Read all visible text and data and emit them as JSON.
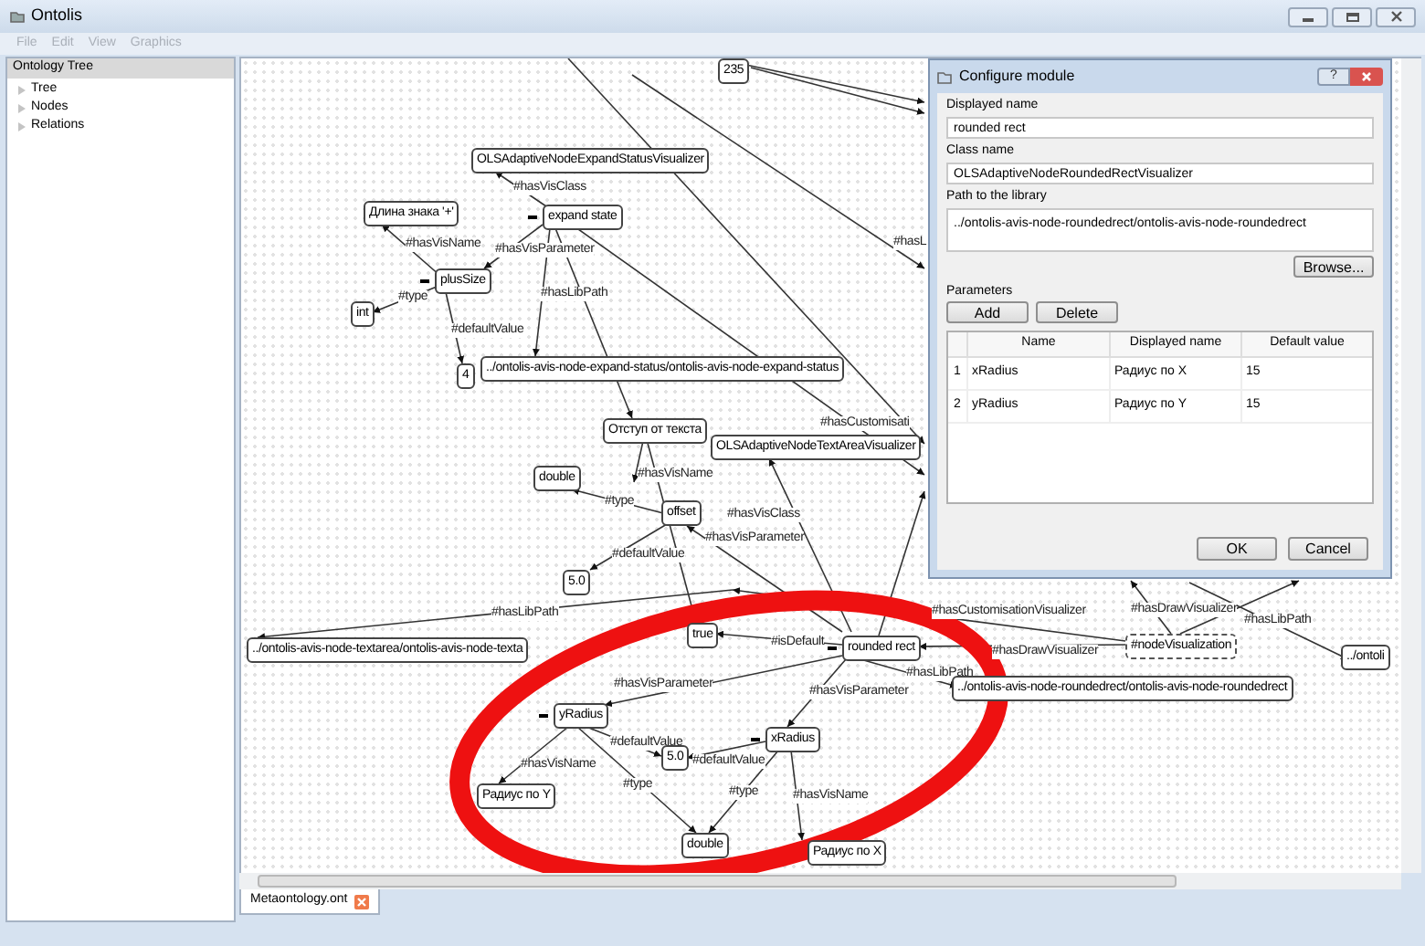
{
  "window": {
    "title": "Ontolis"
  },
  "menu": [
    {
      "label": "File",
      "disabled": true
    },
    {
      "label": "Edit",
      "disabled": true
    },
    {
      "label": "View",
      "disabled": true
    },
    {
      "label": "Graphics",
      "disabled": true
    }
  ],
  "sidebar": {
    "title": "Ontology Tree",
    "items": [
      {
        "label": "Tree",
        "expanded": false
      },
      {
        "label": "Nodes",
        "expanded": false
      },
      {
        "label": "Relations",
        "expanded": false
      }
    ]
  },
  "graph": {
    "nodes": [
      {
        "label": "235",
        "dashed": false
      },
      {
        "label": "OLSAdaptiveNodeExpandStatusVisualizer",
        "dashed": false
      },
      {
        "label": "Длина знака '+'",
        "dashed": false
      },
      {
        "label": "expand state",
        "dashed": false,
        "expanded": true
      },
      {
        "label": "plusSize",
        "dashed": false,
        "expanded": true
      },
      {
        "label": "int",
        "dashed": false
      },
      {
        "label": "4",
        "dashed": false
      },
      {
        "label": "../ontolis-avis-node-expand-status/ontolis-avis-node-expand-status",
        "dashed": false
      },
      {
        "label": "Отступ от текста",
        "dashed": false
      },
      {
        "label": "OLSAdaptiveNodeTextAreaVisualizer",
        "dashed": false
      },
      {
        "label": "double",
        "dashed": false
      },
      {
        "label": "offset",
        "dashed": false
      },
      {
        "label": "5.0",
        "dashed": false
      },
      {
        "label": "true",
        "dashed": false
      },
      {
        "label": "../ontolis-avis-node-textarea/ontolis-avis-node-texta",
        "dashed": false
      },
      {
        "label": "rounded rect",
        "dashed": false,
        "expanded": true
      },
      {
        "label": "#nodeVisualization",
        "dashed": true
      },
      {
        "label": "../ontolis-avis-node-roundedrect/ontolis-avis-node-roundedrect",
        "dashed": false
      },
      {
        "label": "../ontoli",
        "dashed": false
      },
      {
        "label": "yRadius",
        "dashed": false,
        "expanded": true
      },
      {
        "label": "xRadius",
        "dashed": false,
        "expanded": true
      },
      {
        "label": "5.0",
        "dashed": false
      },
      {
        "label": "Радиус по Y",
        "dashed": false
      },
      {
        "label": "double",
        "dashed": false
      },
      {
        "label": "Радиус по X",
        "dashed": false
      }
    ],
    "edge_labels": [
      "#hasVisClass",
      "#hasVisName",
      "#hasVisParameter",
      "#type",
      "#hasLibPath",
      "#defaultValue",
      "#hasL",
      "#hasCustomisati",
      "#hasVisName",
      "#type",
      "#hasVisClass",
      "#defaultValue",
      "#hasVisParameter",
      "#hasLibPath",
      "#isDefault",
      "#hasCustomisationVisualizer",
      "#hasDrawVisualizer",
      "#hasDrawVisualizer",
      "#hasLibPath",
      "#hasLibPath",
      "#hasVisParameter",
      "#hasVisParameter",
      "#defaultValue",
      "#defaultValue",
      "#hasVisName",
      "#type",
      "#type",
      "#hasVisName"
    ]
  },
  "tabs": [
    {
      "label": "Metaontology.ont",
      "selected": true
    }
  ],
  "dialog": {
    "title": "Configure module",
    "help": "?",
    "fields": [
      {
        "label": "Displayed name",
        "value": "rounded rect"
      },
      {
        "label": "Class name",
        "value": "OLSAdaptiveNodeRoundedRectVisualizer"
      },
      {
        "label": "Path to the library",
        "value": "../ontolis-avis-node-roundedrect/ontolis-avis-node-roundedrect"
      }
    ],
    "browse": "Browse...",
    "parameters_label": "Parameters",
    "add": "Add",
    "delete": "Delete",
    "table": {
      "columns": [
        "Name",
        "Displayed name",
        "Default value"
      ],
      "rows": [
        {
          "number": "1",
          "cells": [
            "xRadius",
            "Радиус по X",
            "15"
          ]
        },
        {
          "number": "2",
          "cells": [
            "yRadius",
            "Радиус по Y",
            "15"
          ]
        }
      ]
    },
    "ok": "OK",
    "cancel": "Cancel"
  }
}
